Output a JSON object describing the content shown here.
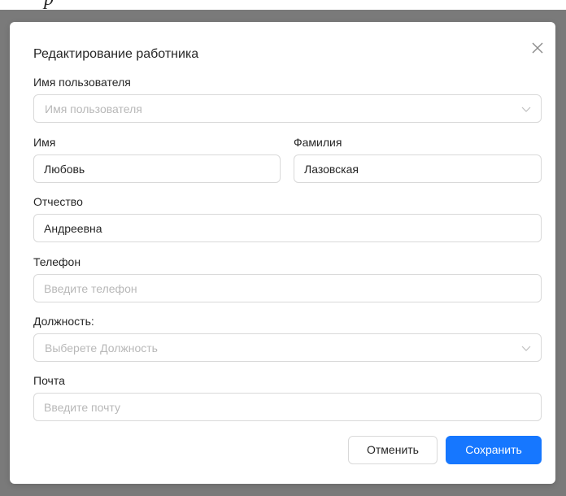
{
  "modal": {
    "title": "Редактирование работника",
    "username": {
      "label": "Имя пользователя",
      "placeholder": "Имя пользователя"
    },
    "first_name": {
      "label": "Имя",
      "value": "Любовь"
    },
    "last_name": {
      "label": "Фамилия",
      "value": "Лазовская"
    },
    "patronymic": {
      "label": "Отчество",
      "value": "Андреевна"
    },
    "phone": {
      "label": "Телефон",
      "placeholder": "Введите телефон"
    },
    "position": {
      "label": "Должность:",
      "placeholder": "Выберете Должность"
    },
    "email": {
      "label": "Почта",
      "placeholder": "Введите почту"
    },
    "buttons": {
      "cancel": "Отменить",
      "save": "Сохранить"
    }
  },
  "colors": {
    "primary": "#1677ff",
    "overlay": "#7a7a7a",
    "border": "#d9d9d9",
    "placeholder": "#b8b8b8"
  },
  "icons": {
    "close": "close-icon",
    "dropdown": "chevron-down-icon"
  }
}
